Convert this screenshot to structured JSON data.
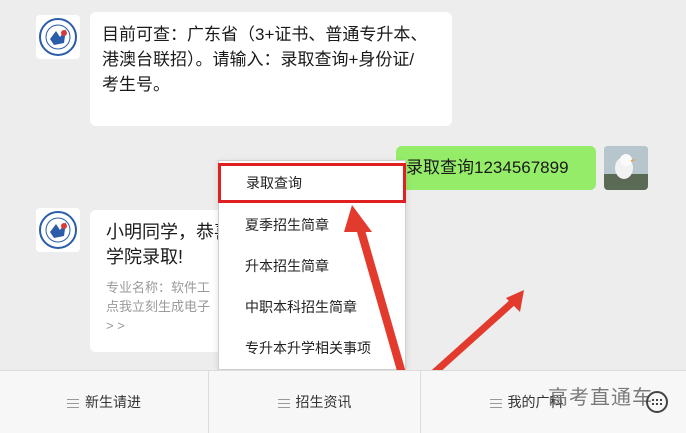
{
  "messages": {
    "bot_intro_lines": [
      "目前可查：广东省（3+证书、普通专升本、",
      "港澳台联招）。请输入：录取查询+身份证/",
      "考生号。"
    ],
    "user_query": "录取查询1234567899",
    "bot_reply_lines": [
      "小明同学，恭喜",
      "学院录取!"
    ],
    "bot_reply_detail_lines": [
      "专业名称：软件工",
      "点我立刻生成电子",
      "> >"
    ]
  },
  "menu": {
    "items": [
      "录取查询",
      "夏季招生简章",
      "升本招生简章",
      "中职本科招生简章",
      "专升本升学相关事项"
    ]
  },
  "bottom_bar": {
    "tabs": [
      "新生请进",
      "招生资讯",
      "我的广科"
    ]
  },
  "watermark": "高考直通车",
  "colors": {
    "accent_red": "#e02020",
    "user_bubble": "#95ec69"
  }
}
